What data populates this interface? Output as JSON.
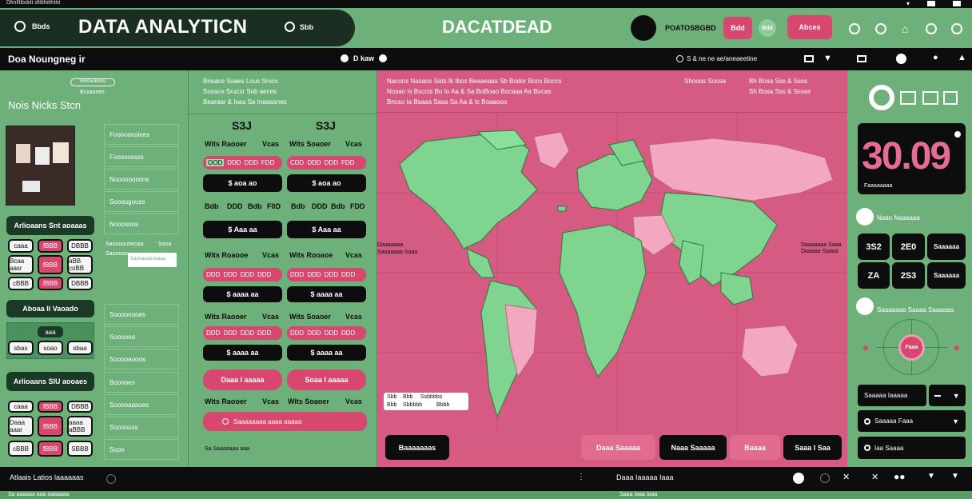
{
  "top_strip": {
    "left_text": "Dfinlltlbdiilt dtttlttitthttit"
  },
  "header": {
    "nav_left_label": "Bbds",
    "title": "DATA ANALYTICN",
    "nav_mid_label": "Sbb",
    "center_title": "DACATDEAD",
    "user_label": "POATOSBGBD",
    "btn_1": "Bdd",
    "btn_2": "Bdd",
    "btn_3": "Abces"
  },
  "toolbar": {
    "left_title": "Doa Noungneg ir",
    "mid_label": "D kaw",
    "right_text": "S & ne ne ae/aneaeetine"
  },
  "left_panel": {
    "chip": "Bnmaubbos",
    "sub": "Bcxaanes",
    "heading": "Nois Nicks Stcn",
    "list_top": [
      "Foooooosiees",
      "Foooosssss",
      "Noooooosons",
      "Sooougouss",
      "Nooosoos"
    ],
    "section_1": "Arlioaans Snt aoaaas",
    "grid_1": [
      [
        "caaa",
        "fBBB",
        "DBBB"
      ],
      [
        "Bcaa aasr",
        "fBBB",
        "aBB coBB"
      ],
      [
        "cBBB",
        "fBBB",
        "DBBB"
      ]
    ],
    "section_2": "Aboaa Ii Vaoado",
    "grid_2_top": [
      "",
      "aaa",
      ""
    ],
    "grid_2": [
      "sbas",
      "soao",
      "sbaa"
    ],
    "section_3": "Arlioaans SIU aooaes",
    "grid_3": [
      [
        "caaa",
        "fBBB",
        "DBBB"
      ],
      [
        "Daaa aaar",
        "fBBB",
        "aaaa aBBB"
      ],
      [
        "cBBB",
        "fBBB",
        "SBBB"
      ]
    ],
    "mid_labels": [
      "Saoooouoeoaa",
      "Saoa",
      "Saoooao"
    ],
    "mid_input": "Saonaaaoooaaa",
    "list_bottom": [
      "Soooooooes",
      "Soooooa",
      "Sooooaooos",
      "Boonoes",
      "Sooooaasoes",
      "Soooouss",
      "Soon"
    ]
  },
  "stats_panel": {
    "header_lines": [
      "Bnaace Ssaes Lous Srocs",
      "Susace Srucsr Sob aeces",
      "Bearaar & Ioas Sa Inaaasnes"
    ],
    "col_title_left": "S3J",
    "col_title_right": "S3J",
    "sections": [
      {
        "labels": [
          "Wits Raooer",
          "Vcas",
          "Wits Soaoer",
          "Vcas"
        ],
        "pink_left": [
          "OOD",
          "DDD",
          "DDD",
          "FDD"
        ],
        "pink_right": [
          "CDD",
          "DDD",
          "DDD",
          "FDD"
        ],
        "black_left": "$ aoa ao",
        "black_right": "$ aoa ao"
      },
      {
        "labels": [
          "Bdb",
          "DDD",
          "Bdb",
          "F0D",
          "Bdb",
          "DDD",
          "Bdb",
          "FDD"
        ],
        "black_left": "$ Aaa aa",
        "black_right": "$ Aaa aa"
      },
      {
        "labels": [
          "Wits Roaooe",
          "Vcas",
          "Wits Rooaoe",
          "Vcas"
        ],
        "pink_left": [
          "DDD",
          "DDD",
          "DDD",
          "DDD"
        ],
        "pink_right": [
          "DDD",
          "DDD",
          "DDD",
          "DDD"
        ],
        "black_left": "$ aaaa aa",
        "black_right": "$ aaaa aa"
      },
      {
        "labels": [
          "Wits Raooer",
          "Vcas",
          "Wits Soaoer",
          "Vcas"
        ],
        "pink_left": [
          "DDD",
          "DDD",
          "DDD",
          "DDD"
        ],
        "pink_right": [
          "DDD",
          "DDD",
          "DDD",
          "DDD"
        ],
        "black_left": "$ aaaa aa",
        "black_right": "$ aaaa aa"
      }
    ],
    "pink_btn_left": "Daaa I aaaaa",
    "pink_btn_right": "Soaa I aaaaa",
    "footer_labels": [
      "Wits Raooer",
      "Vcas",
      "Wits Soaoer",
      "Vcas"
    ],
    "wide_pink": "Saaaaaaaa aaaa aaaaa",
    "footnote": "Sa.Saaaaaaa aaa"
  },
  "map_panel": {
    "header_lines": [
      "Nacons Nasaos Sats Ik Ibos Beaaeaas Sb Bodor Bocs Boccs",
      "Nosao Is Bsccts Bo Io Aa & Sa BoBoao Bocaaa Aa Bocas",
      "Bncso Ia Bsaaa Sasa Sa Aa & Ic Boaaooo"
    ],
    "header_right": [
      "Shooos Soosa",
      "Bh Bosa Sss & Ssss",
      "Sh Bosa Sss & Sssas"
    ],
    "side_labels_left": [
      "Daaaaaaa",
      "Saaaaaaa Saaa"
    ],
    "side_labels_right": [
      "Daaaaaaa Saaa",
      "Daaaaa Saaaa"
    ],
    "legend": [
      "Sbb",
      "Bbb",
      "Ssbbbbs",
      "Bbb",
      "Sbbbbb",
      "Bbbb"
    ],
    "btn_left": "Baaaaaaas",
    "btn_1": "Daaa Saaaaa",
    "btn_2": "Naaa Saaaaa",
    "btn_3": "Baaaa",
    "btn_4": "Saaa I Saa"
  },
  "right_panel": {
    "big_number": "30.09",
    "big_caption": "Faaaaaaaa",
    "label_1": "Naao Naaaaaa",
    "grid": [
      [
        "3S2",
        "2E0",
        "Saaaaaa"
      ],
      [
        "ZA",
        "2S3",
        "Saaaaaa"
      ]
    ],
    "label_2": "Saaaaaaa Saaaa Saaaaaa",
    "dial_label": "Faaa",
    "dropdown_1": "Saaaaa Iaaaaa",
    "dropdown_2": "Saaaaa Faaa",
    "dropdown_3": "Iaa Saaaa"
  },
  "footer": {
    "left_text": "Atlaais Latios laaaaaas",
    "center_text": "Daaa Iaaaaa Iaaa",
    "bottom_text": "Sa aaaaaa aaa aaaaaaa",
    "bottom_center": "Saaa Iaaa Iaaa"
  },
  "colors": {
    "green": "#6db07a",
    "pink": "#d7476f",
    "light_pink": "#e88aa8",
    "dark": "#0d0d0d"
  }
}
